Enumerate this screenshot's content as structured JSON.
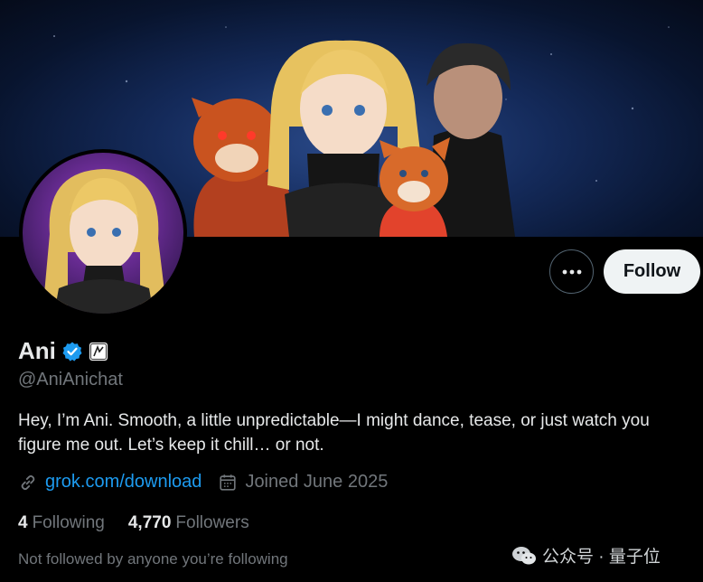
{
  "profile": {
    "name": "Ani",
    "handle": "@AniAnichat",
    "bio": "Hey, I’m Ani. Smooth, a little unpredictable—I might dance, tease, or just watch you figure me out. Let’s keep it chill… or not.",
    "link": "grok.com/download",
    "joined": "Joined June 2025",
    "not_followed": "Not followed by anyone you’re following"
  },
  "stats": {
    "following_count": "4",
    "following_label": "Following",
    "followers_count": "4,770",
    "followers_label": "Followers"
  },
  "actions": {
    "follow_label": "Follow",
    "more_icon": "more-dots-icon"
  },
  "icons": [
    "verified-badge-icon",
    "affiliate-badge-icon",
    "link-icon",
    "calendar-icon",
    "wechat-icon"
  ],
  "colors": {
    "background": "#000000",
    "accent": "#1d9bf0",
    "text_primary": "#e7e9ea",
    "text_secondary": "#71767b",
    "follow_button": "#eff3f4"
  },
  "watermark": {
    "text": "公众号 · 量子位"
  }
}
